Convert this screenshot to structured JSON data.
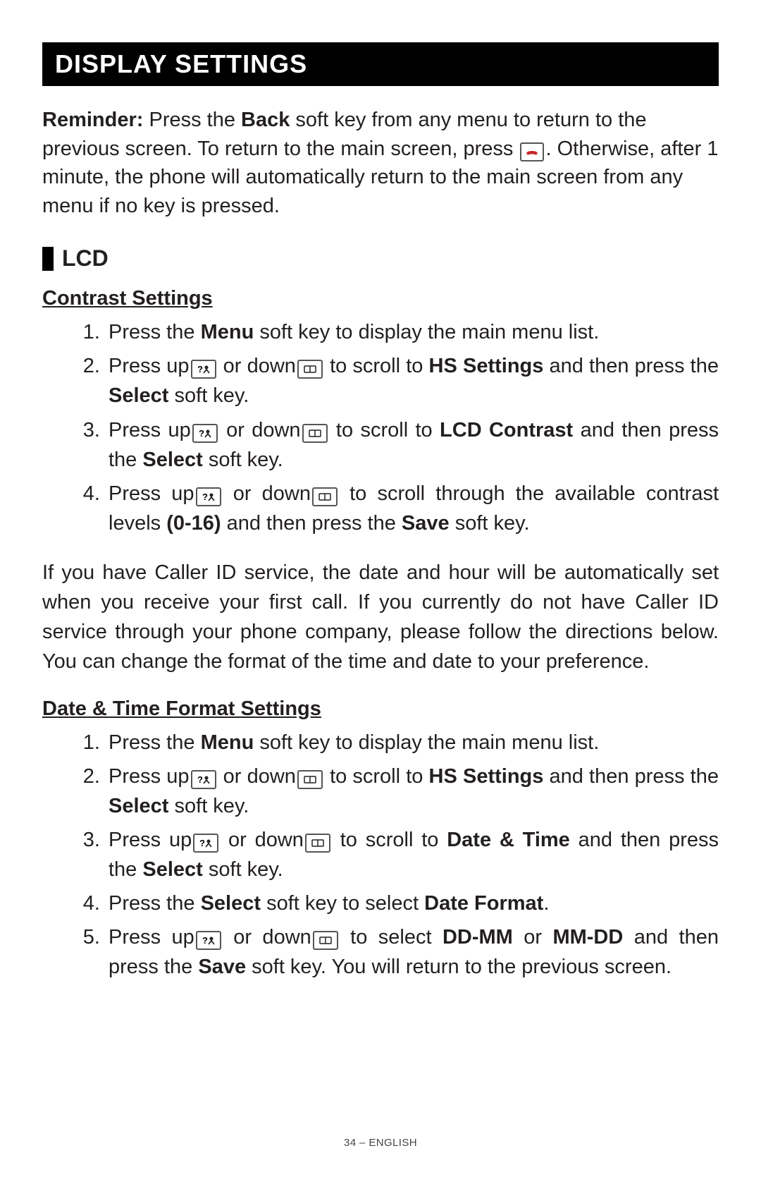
{
  "title": "DISPLAY SETTINGS",
  "reminder": {
    "label": "Reminder:",
    "p1a": " Press the ",
    "back": "Back",
    "p1b": " soft key from any menu to return to the previous screen.  To return to the main screen, press ",
    "p1c": ".  Otherwise, after 1 minute, the phone will automatically return to the main screen from any menu if no key is pressed."
  },
  "section_lcd": "LCD",
  "contrast": {
    "heading": "Contrast Settings",
    "s1a": "Press the ",
    "s1b": "Menu",
    "s1c": " soft key to display the main menu list.",
    "s2a": "Press up",
    "s2b": " or down",
    "s2c": " to scroll to ",
    "s2d": "HS Settings",
    "s2e": " and then press the ",
    "s2f": "Select",
    "s2g": " soft key.",
    "s3a": "Press up",
    "s3b": " or down",
    "s3c": " to scroll to ",
    "s3d": "LCD Contrast",
    "s3e": " and then press the ",
    "s3f": "Select",
    "s3g": " soft key.",
    "s4a": "Press up",
    "s4b": " or down",
    "s4c": " to scroll through the available contrast levels ",
    "s4d": "(0-16)",
    "s4e": " and then press the ",
    "s4f": "Save",
    "s4g": " soft key."
  },
  "callerid_para": "If you have Caller ID service, the date and hour will be automatically set when you receive your first call. If you currently do not have Caller ID service through your phone company, please follow the directions below.  You can change the format of the time and date to your preference.",
  "datetime": {
    "heading": "Date & Time Format Settings",
    "s1a": "Press the ",
    "s1b": "Menu",
    "s1c": " soft key to display the main menu list.",
    "s2a": "Press up",
    "s2b": " or down",
    "s2c": " to scroll to ",
    "s2d": "HS Settings",
    "s2e": " and then press the ",
    "s2f": "Select",
    "s2g": " soft key.",
    "s3a": "Press up",
    "s3b": " or down",
    "s3c": " to scroll to ",
    "s3d": "Date & Time",
    "s3e": " and then press the ",
    "s3f": "Select",
    "s3g": " soft key.",
    "s4a": "Press the ",
    "s4b": "Select",
    "s4c": " soft key to select ",
    "s4d": "Date Format",
    "s4e": ".",
    "s5a": "Press up",
    "s5b": " or down",
    "s5c": " to select ",
    "s5d": "DD-MM",
    "s5e": " or ",
    "s5f": "MM-DD",
    "s5g": " and then press the ",
    "s5h": "Save",
    "s5i": " soft key.  You will return to the previous screen."
  },
  "footer": "34 – ENGLISH",
  "icons": {
    "phone": "☎",
    "up": "?▲",
    "down": "📖"
  }
}
